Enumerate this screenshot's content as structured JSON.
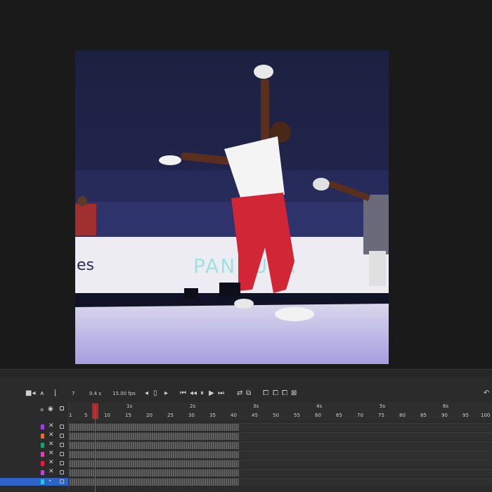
{
  "timeline": {
    "current_frame": "7",
    "time": "0.4 s",
    "fps": "15.00 fps",
    "second_labels": [
      "1s",
      "2s",
      "3s",
      "4s",
      "5s",
      "6s"
    ],
    "frame_labels": [
      "1",
      "5",
      "10",
      "15",
      "20",
      "25",
      "30",
      "35",
      "40",
      "45",
      "50",
      "55",
      "60",
      "65",
      "70",
      "75",
      "80",
      "85",
      "90",
      "95",
      "100"
    ],
    "layers": [
      {
        "color": "#a040e0",
        "selected": false
      },
      {
        "color": "#e07020",
        "selected": false
      },
      {
        "color": "#20a070",
        "selected": false
      },
      {
        "color": "#e040b0",
        "selected": false
      },
      {
        "color": "#e02040",
        "selected": false
      },
      {
        "color": "#c040e0",
        "selected": false
      },
      {
        "color": "#30c0e0",
        "selected": true
      }
    ]
  },
  "icons": {
    "camera": "camera-icon",
    "layers": "layer-parenting-icon",
    "graph": "ease-graph-icon",
    "eye": "eye-icon",
    "lock": "lock-icon",
    "first": "first-frame-icon",
    "back": "step-back-icon",
    "play": "play-icon",
    "forward": "step-forward-icon",
    "last": "last-frame-icon",
    "loop": "loop-icon",
    "onion": "onion-skin-icon"
  }
}
